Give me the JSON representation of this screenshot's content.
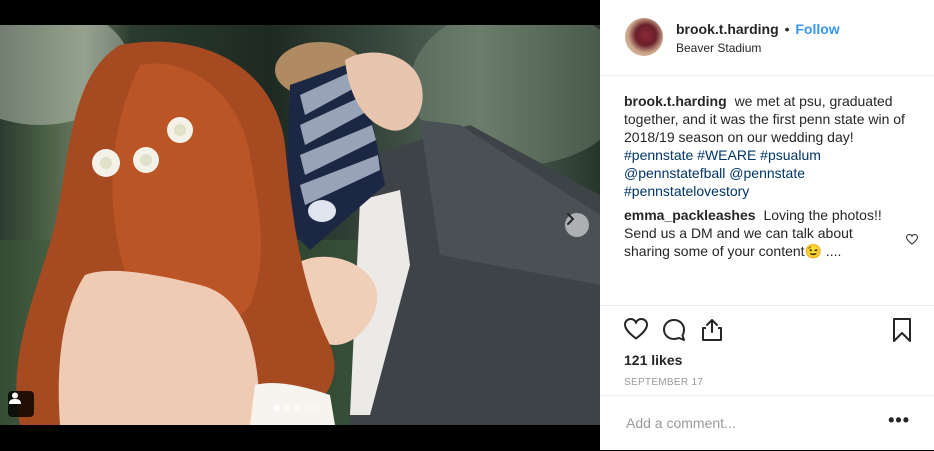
{
  "post": {
    "username": "brook.t.harding",
    "follow_label": "Follow",
    "bullet": "•",
    "location": "Beaver Stadium"
  },
  "caption": {
    "username": "brook.t.harding",
    "text": "we met at psu, graduated together, and it was the first penn state win of 2018/19 season on our wedding day!",
    "tags": "#pennstate #WEARE #psualum @pennstatefball @pennstate #pennstatelovestory"
  },
  "comment": {
    "username": "emma_packleashes",
    "text": "Loving the photos!! Send us a DM and we can talk about sharing some of your content😉 ...."
  },
  "likes": "121 likes",
  "date": "SEPTEMBER 17",
  "add_comment_placeholder": "Add a comment...",
  "more_label": "•••",
  "carousel": {
    "slides": 5,
    "active_index": 0
  },
  "icons": {
    "like": "heart-icon",
    "comment": "comment-icon",
    "share": "share-icon",
    "save": "bookmark-icon",
    "tagged": "user-tag-icon",
    "next": "chevron-right-icon"
  },
  "colors": {
    "link": "#3897f0",
    "hashtag": "#003569",
    "text": "#262626",
    "muted": "#999999"
  }
}
